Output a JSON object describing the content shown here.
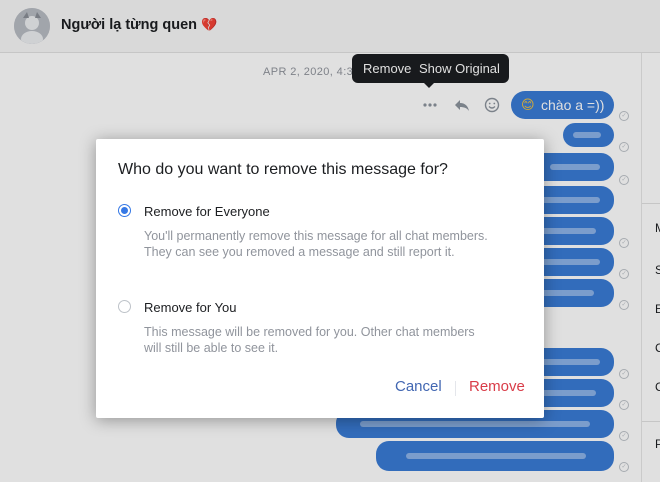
{
  "header": {
    "contact_name": "Người lạ từng quen",
    "heart_emoji": "💔"
  },
  "chat": {
    "date_separator": "APR 2, 2020, 4:3",
    "first_message_emoji": "😊",
    "first_message_text": "chào a =))"
  },
  "tooltip": {
    "remove_label": "Remove",
    "show_original_label": "Show Original"
  },
  "right_panel": {
    "letters": [
      "M",
      "S",
      "E",
      "C",
      "C",
      "P"
    ]
  },
  "modal": {
    "title": "Who do you want to remove this message for?",
    "options": [
      {
        "label": "Remove for Everyone",
        "description": "You'll permanently remove this message for all chat members. They can see you removed a message and still report it.",
        "selected": true
      },
      {
        "label": "Remove for You",
        "description": "This message will be removed for you. Other chat members will still be able to see it.",
        "selected": false
      }
    ],
    "cancel_label": "Cancel",
    "remove_label": "Remove"
  },
  "icons": {
    "more": "more-horizontal-icon",
    "reply": "reply-icon",
    "react": "smiley-icon",
    "seen": "seen-check-icon"
  },
  "colors": {
    "bubble": "#3a7bd5",
    "accent": "#3578e5",
    "danger": "#d93c48",
    "link": "#4267b2"
  }
}
